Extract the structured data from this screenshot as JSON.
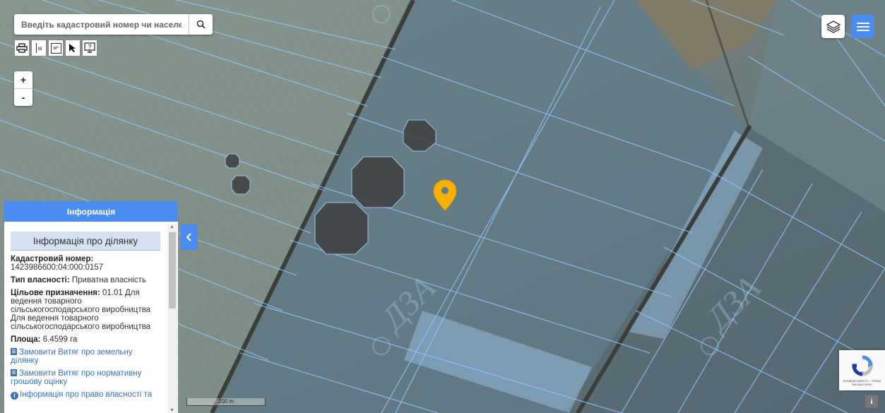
{
  "search": {
    "placeholder": "Введіть кадастровий номер чи населений"
  },
  "tools": [
    {
      "icon": "printer-icon"
    },
    {
      "icon": "ruler-meters-icon",
      "label": "м"
    },
    {
      "icon": "area-measure-icon",
      "label": "м²"
    },
    {
      "icon": "cursor-arrow-icon"
    },
    {
      "icon": "info-monitor-icon"
    }
  ],
  "zoom": {
    "in": "+",
    "out": "-"
  },
  "panel": {
    "header": "Інформація",
    "section_title": "Інформація про ділянку",
    "cadastral_label": "Кадастровий номер:",
    "cadastral_value": "1423986600:04:000:0157",
    "ownership_label": "Тип власності:",
    "ownership_value": "Приватна власність",
    "purpose_label": "Цільове призначення:",
    "purpose_value": "01.01 Для ведення товарного сільськогосподарського виробництва Для ведення товарного сільськогосподарського виробництва",
    "area_label": "Площа:",
    "area_value": "6.4599 га",
    "link_extract": "Замовити Витяг про земельну ділянку",
    "link_valuation": "Замовити Витяг про нормативну грошову оцінку",
    "link_ownership": "Інформація про право власності та"
  },
  "scale": "200 m",
  "recaptcha": {
    "text": "Конфіденційність · Умови використання"
  },
  "info_corner": "i",
  "colors": {
    "accent": "#4a8cf0",
    "marker": "#f5b000",
    "parcel_line": "#8ec8ff"
  }
}
